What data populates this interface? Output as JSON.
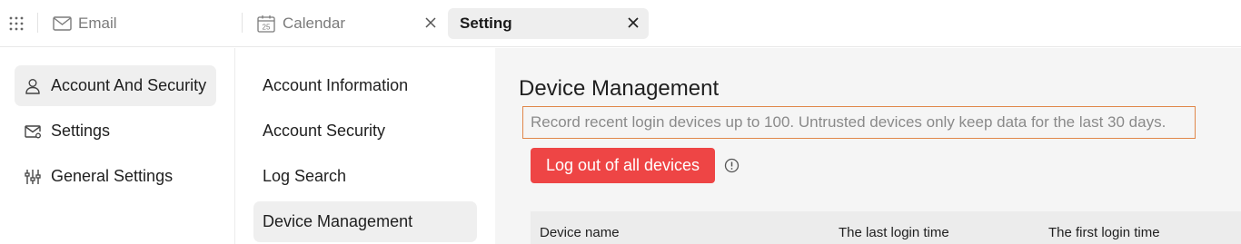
{
  "tabs": {
    "email": {
      "label": "Email",
      "icon": "mail-icon"
    },
    "calendar": {
      "label": "Calendar",
      "icon": "calendar-icon",
      "icon_day": "25"
    },
    "setting": {
      "label": "Setting"
    }
  },
  "sidebar": {
    "items": [
      {
        "label": "Account And Security",
        "icon": "user-icon",
        "active": true
      },
      {
        "label": "Settings",
        "icon": "mail-settings-icon",
        "active": false
      },
      {
        "label": "General Settings",
        "icon": "sliders-icon",
        "active": false
      }
    ]
  },
  "submenu": {
    "items": [
      {
        "label": "Account Information",
        "active": false
      },
      {
        "label": "Account Security",
        "active": false
      },
      {
        "label": "Log Search",
        "active": false
      },
      {
        "label": "Device Management",
        "active": true
      }
    ]
  },
  "main": {
    "title": "Device Management",
    "notice": "Record recent login devices up to 100. Untrusted devices only keep data for the last 30 days.",
    "logout_button": "Log out of all devices",
    "table": {
      "columns": [
        "Device name",
        "The last login time",
        "The first login time"
      ]
    }
  },
  "colors": {
    "accent_button": "#ee4545",
    "notice_border": "#e0874a",
    "active_item_bg": "#efefef",
    "main_bg": "#f5f5f5"
  }
}
